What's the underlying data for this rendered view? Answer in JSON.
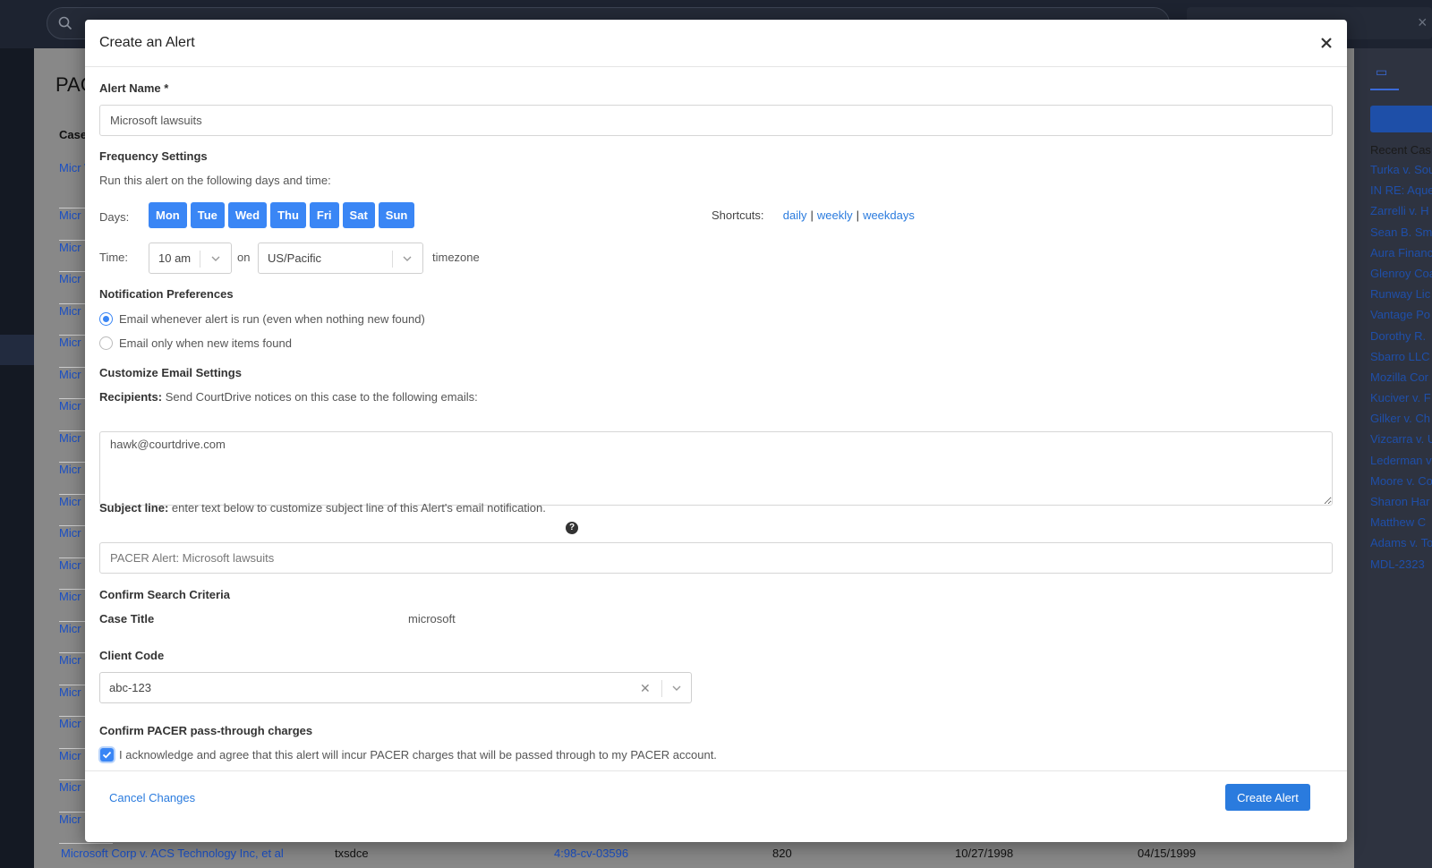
{
  "background": {
    "title": "PAC",
    "case_col_header": "Case",
    "case_links": [
      "Micr Who",
      "Micr",
      "Micr",
      "Micr",
      "Micr",
      "Micr",
      "Micr",
      "Micr",
      "Micr",
      "Micr",
      "Micr",
      "Micr",
      "Micr",
      "Micr",
      "Micr",
      "Micr",
      "Micr",
      "Micr",
      "Micr",
      "Micr",
      "Micr"
    ],
    "bottom_row": {
      "case": "Microsoft Corp v. ACS Technology Inc, et al",
      "court": "txsdce",
      "docket": "4:98-cv-03596",
      "nature": "820",
      "filed": "10/27/1998",
      "closed": "04/15/1999"
    },
    "recent_heading": "Recent Cas",
    "recent_cases": [
      "Turka v. Sou",
      "IN RE: Aque",
      "Zarrelli v. H",
      "Sean B. Sm",
      "Aura Financ",
      "Glenroy Coa",
      "Runway Lic",
      "Vantage Po",
      "Dorothy R.",
      "Sbarro LLC",
      "Mozilla Cor",
      "Kuciver v. F",
      "Gilker v. Ch",
      "Vizcarra v. U",
      "Lederman v",
      "Moore v. Co",
      "Sharon Har",
      "Matthew C",
      "Adams v. To",
      "MDL-2323"
    ]
  },
  "modal": {
    "title": "Create an Alert",
    "alert_name_label": "Alert Name *",
    "alert_name_value": "Microsoft lawsuits",
    "frequency_heading": "Frequency Settings",
    "frequency_help": "Run this alert on the following days and time:",
    "days_label": "Days:",
    "days": [
      "Mon",
      "Tue",
      "Wed",
      "Thu",
      "Fri",
      "Sat",
      "Sun"
    ],
    "shortcuts_label": "Shortcuts:",
    "shortcuts": [
      "daily",
      "weekly",
      "weekdays"
    ],
    "time_label": "Time:",
    "time_value": "10 am",
    "on_label": "on",
    "timezone_value": "US/Pacific",
    "timezone_label": "timezone",
    "notification_heading": "Notification Preferences",
    "notify_always": "Email whenever alert is run (even when nothing new found)",
    "notify_new_only": "Email only when new items found",
    "email_heading": "Customize Email Settings",
    "recipients_label": "Recipients:",
    "recipients_help": "Send CourtDrive notices on this case to the following emails:",
    "recipients_value": "hawk@courtdrive.com",
    "subject_label": "Subject line:",
    "subject_help": "enter text below to customize subject line of this Alert's email notification.",
    "subject_value": "PACER Alert: Microsoft lawsuits",
    "help_icon": "?",
    "confirm_heading": "Confirm Search Criteria",
    "case_title_label": "Case Title",
    "case_title_value": "microsoft",
    "client_code_label": "Client Code",
    "client_code_value": "abc-123",
    "charges_heading": "Confirm PACER pass-through charges",
    "charges_ack": "I acknowledge and agree that this alert will incur PACER charges that will be passed through to my PACER account.",
    "cancel_label": "Cancel Changes",
    "create_label": "Create Alert"
  },
  "colors": {
    "accent": "#3a86f5",
    "link": "#2a7bde"
  }
}
